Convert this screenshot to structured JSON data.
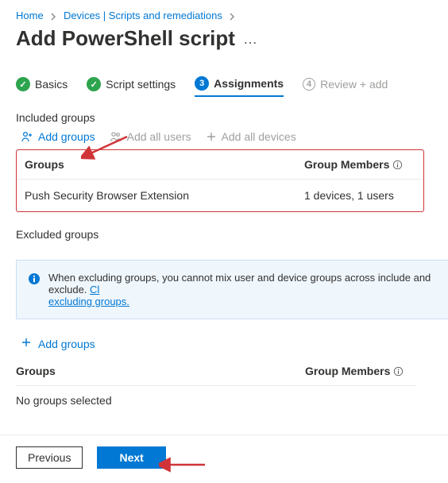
{
  "breadcrumbs": {
    "home": "Home",
    "devices": "Devices | Scripts and remediations"
  },
  "page": {
    "title": "Add PowerShell script"
  },
  "steps": {
    "s1": {
      "label": "Basics"
    },
    "s2": {
      "label": "Script settings"
    },
    "s3": {
      "num": "3",
      "label": "Assignments"
    },
    "s4": {
      "num": "4",
      "label": "Review + add"
    }
  },
  "included": {
    "heading": "Included groups",
    "add_groups": "Add groups",
    "add_all_users": "Add all users",
    "add_all_devices": "Add all devices",
    "table": {
      "col_groups": "Groups",
      "col_members": "Group Members",
      "rows": [
        {
          "name": "Push Security Browser Extension",
          "members": "1 devices, 1 users"
        }
      ]
    }
  },
  "excluded": {
    "heading": "Excluded groups",
    "banner_text": "When excluding groups, you cannot mix user and device groups across include and exclude. ",
    "banner_link": "Click here to learn more about excluding groups.",
    "banner_link_short": "excluding groups.",
    "add_groups": "Add groups",
    "table": {
      "col_groups": "Groups",
      "col_members": "Group Members",
      "empty": "No groups selected"
    }
  },
  "footer": {
    "previous": "Previous",
    "next": "Next"
  }
}
